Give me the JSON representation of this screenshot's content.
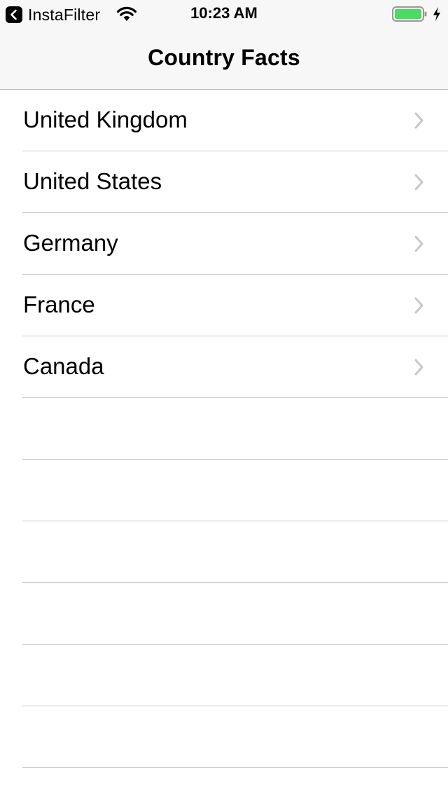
{
  "status_bar": {
    "back_app_label": "InstaFilter",
    "time": "10:23 AM",
    "battery_color": "#4cd964",
    "icons": [
      "back-chevron-icon",
      "wifi-icon",
      "battery-icon",
      "charging-bolt-icon"
    ]
  },
  "navigation": {
    "title": "Country Facts"
  },
  "countries": [
    {
      "label": "United Kingdom"
    },
    {
      "label": "United States"
    },
    {
      "label": "Germany"
    },
    {
      "label": "France"
    },
    {
      "label": "Canada"
    }
  ],
  "colors": {
    "nav_background": "#f7f7f7",
    "separator": "#c8c7cc",
    "chevron": "#c7c7cc"
  }
}
